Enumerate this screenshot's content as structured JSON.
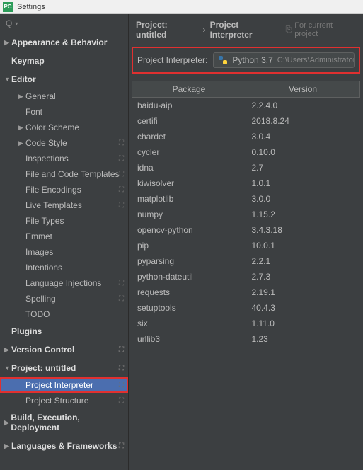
{
  "titlebar": {
    "title": "Settings"
  },
  "search": {
    "placeholder": ""
  },
  "tree": {
    "items": [
      {
        "label": "Appearance & Behavior",
        "type": "section",
        "arrow": "▶"
      },
      {
        "label": "Keymap",
        "type": "section",
        "arrow": ""
      },
      {
        "label": "Editor",
        "type": "section",
        "arrow": "▼"
      },
      {
        "label": "General",
        "type": "child",
        "arrow": "▶"
      },
      {
        "label": "Font",
        "type": "child",
        "arrow": ""
      },
      {
        "label": "Color Scheme",
        "type": "child",
        "arrow": "▶"
      },
      {
        "label": "Code Style",
        "type": "child",
        "arrow": "▶",
        "gear": true
      },
      {
        "label": "Inspections",
        "type": "child",
        "arrow": "",
        "gear": true
      },
      {
        "label": "File and Code Templates",
        "type": "child",
        "arrow": "",
        "gear": true
      },
      {
        "label": "File Encodings",
        "type": "child",
        "arrow": "",
        "gear": true
      },
      {
        "label": "Live Templates",
        "type": "child",
        "arrow": "",
        "gear": true
      },
      {
        "label": "File Types",
        "type": "child",
        "arrow": ""
      },
      {
        "label": "Emmet",
        "type": "child",
        "arrow": ""
      },
      {
        "label": "Images",
        "type": "child",
        "arrow": ""
      },
      {
        "label": "Intentions",
        "type": "child",
        "arrow": ""
      },
      {
        "label": "Language Injections",
        "type": "child",
        "arrow": "",
        "gear": true
      },
      {
        "label": "Spelling",
        "type": "child",
        "arrow": "",
        "gear": true
      },
      {
        "label": "TODO",
        "type": "child",
        "arrow": ""
      },
      {
        "label": "Plugins",
        "type": "section",
        "arrow": ""
      },
      {
        "label": "Version Control",
        "type": "section",
        "arrow": "▶",
        "gear": true
      },
      {
        "label": "Project: untitled",
        "type": "section",
        "arrow": "▼",
        "gear": true
      },
      {
        "label": "Project Interpreter",
        "type": "child",
        "arrow": "",
        "gear": true,
        "selected": true,
        "highlight": true
      },
      {
        "label": "Project Structure",
        "type": "child",
        "arrow": "",
        "gear": true
      },
      {
        "label": "Build, Execution, Deployment",
        "type": "section",
        "arrow": "▶"
      },
      {
        "label": "Languages & Frameworks",
        "type": "section",
        "arrow": "▶",
        "gear": true
      }
    ]
  },
  "breadcrumb": {
    "seg1": "Project: untitled",
    "sep": "›",
    "seg2": "Project Interpreter",
    "for_project": "For current project"
  },
  "interpreter": {
    "label": "Project Interpreter:",
    "name": "Python 3.7",
    "path": "C:\\Users\\Administrator\\AppData\\Local\\Pr"
  },
  "table": {
    "headers": {
      "pkg": "Package",
      "ver": "Version"
    },
    "rows": [
      {
        "pkg": "baidu-aip",
        "ver": "2.2.4.0"
      },
      {
        "pkg": "certifi",
        "ver": "2018.8.24"
      },
      {
        "pkg": "chardet",
        "ver": "3.0.4"
      },
      {
        "pkg": "cycler",
        "ver": "0.10.0"
      },
      {
        "pkg": "idna",
        "ver": "2.7"
      },
      {
        "pkg": "kiwisolver",
        "ver": "1.0.1"
      },
      {
        "pkg": "matplotlib",
        "ver": "3.0.0"
      },
      {
        "pkg": "numpy",
        "ver": "1.15.2"
      },
      {
        "pkg": "opencv-python",
        "ver": "3.4.3.18"
      },
      {
        "pkg": "pip",
        "ver": "10.0.1"
      },
      {
        "pkg": "pyparsing",
        "ver": "2.2.1"
      },
      {
        "pkg": "python-dateutil",
        "ver": "2.7.3"
      },
      {
        "pkg": "requests",
        "ver": "2.19.1"
      },
      {
        "pkg": "setuptools",
        "ver": "40.4.3"
      },
      {
        "pkg": "six",
        "ver": "1.11.0"
      },
      {
        "pkg": "urllib3",
        "ver": "1.23"
      }
    ]
  }
}
